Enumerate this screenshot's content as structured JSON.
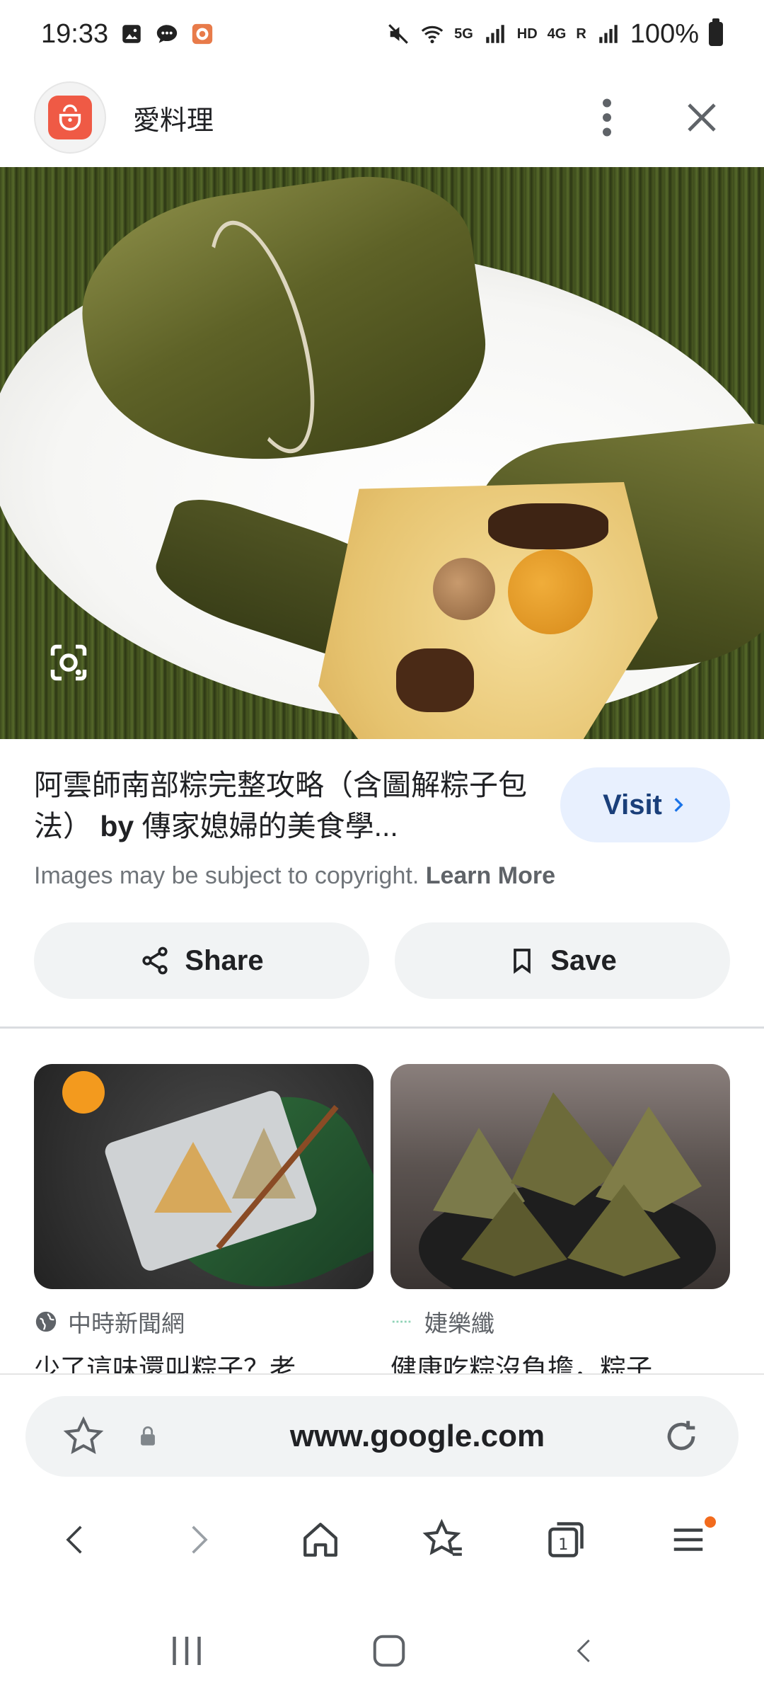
{
  "status_bar": {
    "time": "19:33",
    "net_5g": "5G",
    "net_hd": "HD",
    "net_4g": "4G",
    "net_r": "R",
    "battery": "100%"
  },
  "header": {
    "app_title": "愛料理"
  },
  "result": {
    "title_main": "阿雲師南部粽完整攻略（含圖解粽子包法）",
    "title_by": " by ",
    "title_rest": "傳家媳婦的美食學...",
    "visit_label": "Visit",
    "copyright_text": "Images may be subject to copyright. ",
    "learn_more": "Learn More",
    "share_label": "Share",
    "save_label": "Save"
  },
  "related": [
    {
      "source": "中時新聞網",
      "title": "少了這味還叫粽子？老..."
    },
    {
      "source": "婕樂纖",
      "title": "健康吃粽沒負擔，粽子..."
    }
  ],
  "browser": {
    "url": "www.google.com"
  },
  "colors": {
    "accent": "#e8f0fe",
    "visit_text": "#1a3f7a",
    "notification_dot": "#f26b1d",
    "app_logo": "#ef5a45"
  }
}
